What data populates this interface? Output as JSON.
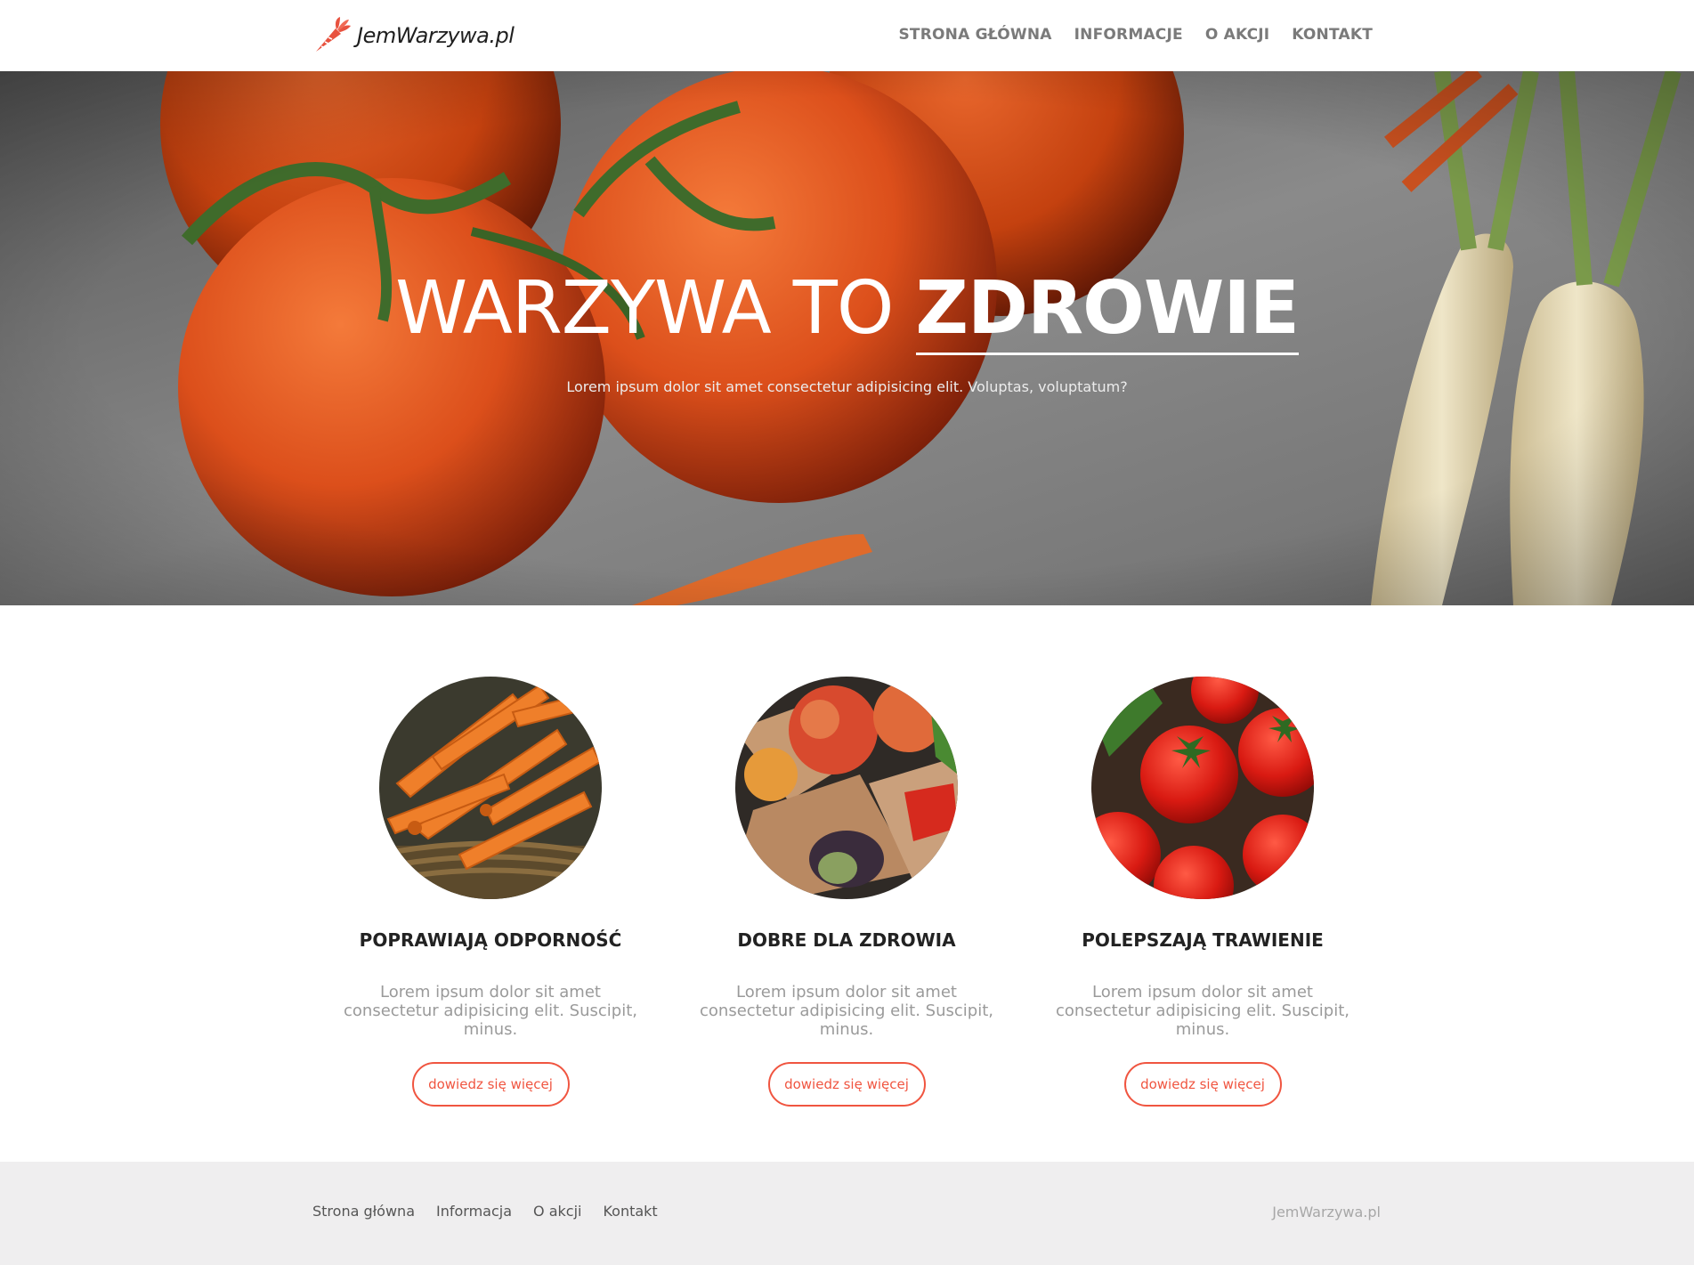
{
  "header": {
    "logo_text": "JemWarzywa.pl",
    "logo_icon": "carrot-icon",
    "nav": [
      {
        "label": "STRONA GŁÓWNA"
      },
      {
        "label": "INFORMACJE"
      },
      {
        "label": "O AKCJI"
      },
      {
        "label": "KONTAKT"
      }
    ]
  },
  "hero": {
    "title_light": "WARZYWA TO ",
    "title_bold": "ZDROWIE",
    "subtitle": "Lorem ipsum dolor sit amet consectetur adipisicing elit. Voluptas, voluptatum?"
  },
  "features": [
    {
      "image": "carrots-photo",
      "title": "POPRAWIAJĄ ODPORNOŚĆ",
      "text": "Lorem ipsum dolor sit amet consectetur adipisicing elit. Suscipit, minus.",
      "button": "dowiedz się więcej"
    },
    {
      "image": "mixed-vegetables-photo",
      "title": "DOBRE DLA ZDROWIA",
      "text": "Lorem ipsum dolor sit amet consectetur adipisicing elit. Suscipit, minus.",
      "button": "dowiedz się więcej"
    },
    {
      "image": "tomatoes-photo",
      "title": "POLEPSZAJĄ TRAWIENIE",
      "text": "Lorem ipsum dolor sit amet consectetur adipisicing elit. Suscipit, minus.",
      "button": "dowiedz się więcej"
    }
  ],
  "footer": {
    "nav": [
      {
        "label": "Strona główna"
      },
      {
        "label": "Informacja"
      },
      {
        "label": "O akcji"
      },
      {
        "label": "Kontakt"
      }
    ],
    "brand": "JemWarzywa.pl"
  },
  "colors": {
    "accent": "#f05540",
    "nav_text": "#7a7a7a",
    "footer_bg": "#efeeef"
  }
}
